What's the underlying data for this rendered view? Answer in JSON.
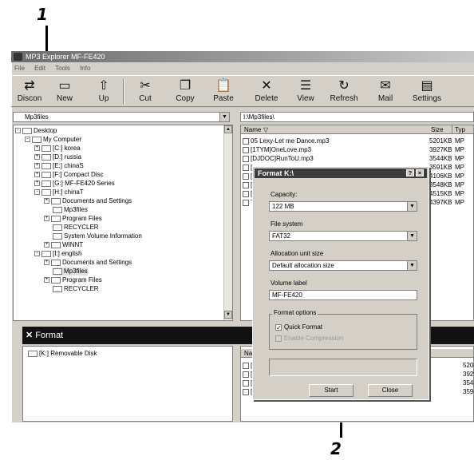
{
  "callouts": {
    "step1": "1",
    "step2": "2"
  },
  "app": {
    "title": "MP3 Explorer MF-FE420"
  },
  "menu": [
    "File",
    "Edit",
    "Tools",
    "Info"
  ],
  "toolbar": {
    "buttons": [
      {
        "label": "Discon",
        "icon": "disconnect-icon",
        "glyph": "⇄"
      },
      {
        "label": "New",
        "icon": "new-folder-icon",
        "glyph": "▭"
      },
      {
        "label": "Up",
        "icon": "up-folder-icon",
        "glyph": "⇧"
      },
      {
        "label": "Cut",
        "icon": "scissors-icon",
        "glyph": "✂"
      },
      {
        "label": "Copy",
        "icon": "copy-icon",
        "glyph": "❐"
      },
      {
        "label": "Paste",
        "icon": "paste-icon",
        "glyph": "📋"
      },
      {
        "label": "Delete",
        "icon": "delete-icon",
        "glyph": "✕"
      },
      {
        "label": "View",
        "icon": "view-icon",
        "glyph": "☰"
      },
      {
        "label": "Refresh",
        "icon": "refresh-icon",
        "glyph": "↻"
      },
      {
        "label": "Mail",
        "icon": "mail-icon",
        "glyph": "✉"
      },
      {
        "label": "Settings",
        "icon": "settings-icon",
        "glyph": "▤"
      }
    ]
  },
  "left_path": "Mp3files",
  "right_path": "I:\\Mp3files\\",
  "tree": [
    {
      "label": "Desktop",
      "pm": "-"
    },
    {
      "label": "My Computer",
      "pm": "-"
    },
    {
      "label": "[C:] korea",
      "pm": "+"
    },
    {
      "label": "[D:] russia",
      "pm": "+"
    },
    {
      "label": "[E:] chinaS",
      "pm": "+"
    },
    {
      "label": "[F:] Compact Disc",
      "pm": "+"
    },
    {
      "label": "[G:] MF-FE420 Series",
      "pm": "+"
    },
    {
      "label": "[H:] chinaT",
      "pm": "-"
    },
    {
      "label": "Documents and Settings",
      "pm": "+"
    },
    {
      "label": "Mp3files",
      "pm": ""
    },
    {
      "label": "Program Files",
      "pm": "+"
    },
    {
      "label": "RECYCLER",
      "pm": ""
    },
    {
      "label": "System Volume Information",
      "pm": ""
    },
    {
      "label": "WINNT",
      "pm": "+"
    },
    {
      "label": "[I:] english",
      "pm": "-"
    },
    {
      "label": "Documents and Settings",
      "pm": "+"
    },
    {
      "label": "Mp3files",
      "pm": ""
    },
    {
      "label": "Program Files",
      "pm": "+"
    },
    {
      "label": "RECYCLER",
      "pm": ""
    }
  ],
  "list": {
    "headers": {
      "name": "Name",
      "size": "Size",
      "type": "Typ"
    },
    "rows": [
      {
        "name": "05 Lexy-Let me Dance.mp3",
        "size": "5201KB",
        "type": "MP"
      },
      {
        "name": "[1TYM]OneLove.mp3",
        "size": "3927KB",
        "type": "MP"
      },
      {
        "name": "[DJDOC]RunToU.mp3",
        "size": "3544KB",
        "type": "MP"
      },
      {
        "name": "[",
        "size": "3591KB",
        "type": "MP"
      },
      {
        "name": "[",
        "size": "4106KB",
        "type": "MP"
      },
      {
        "name": "[",
        "size": "3548KB",
        "type": "MP"
      },
      {
        "name": "[",
        "size": "4515KB",
        "type": "MP"
      },
      {
        "name": "T",
        "size": "4397KB",
        "type": "MP"
      }
    ]
  },
  "format_bar": {
    "label": "Format"
  },
  "bottom_tree": {
    "item": "[K:] Removable Disk"
  },
  "bottom_list": {
    "header": "Nar",
    "rows": [
      {
        "name": "[",
        "size": "520"
      },
      {
        "name": "[",
        "size": "392"
      },
      {
        "name": "[",
        "size": "354"
      },
      {
        "name": "[",
        "size": "359"
      }
    ]
  },
  "dialog": {
    "title": "Format K:\\",
    "help": "?",
    "close": "×",
    "capacity_label": "Capacity:",
    "capacity_value": "122 MB",
    "filesystem_label": "File system",
    "filesystem_value": "FAT32",
    "alloc_label": "Allocation unit size",
    "alloc_value": "Default allocation size",
    "volume_label": "Volume label",
    "volume_value": "MF-FE420",
    "options_title": "Format options",
    "quick_format": "Quick Format",
    "enable_compression": "Enable Compression",
    "start": "Start",
    "close_btn": "Close"
  }
}
